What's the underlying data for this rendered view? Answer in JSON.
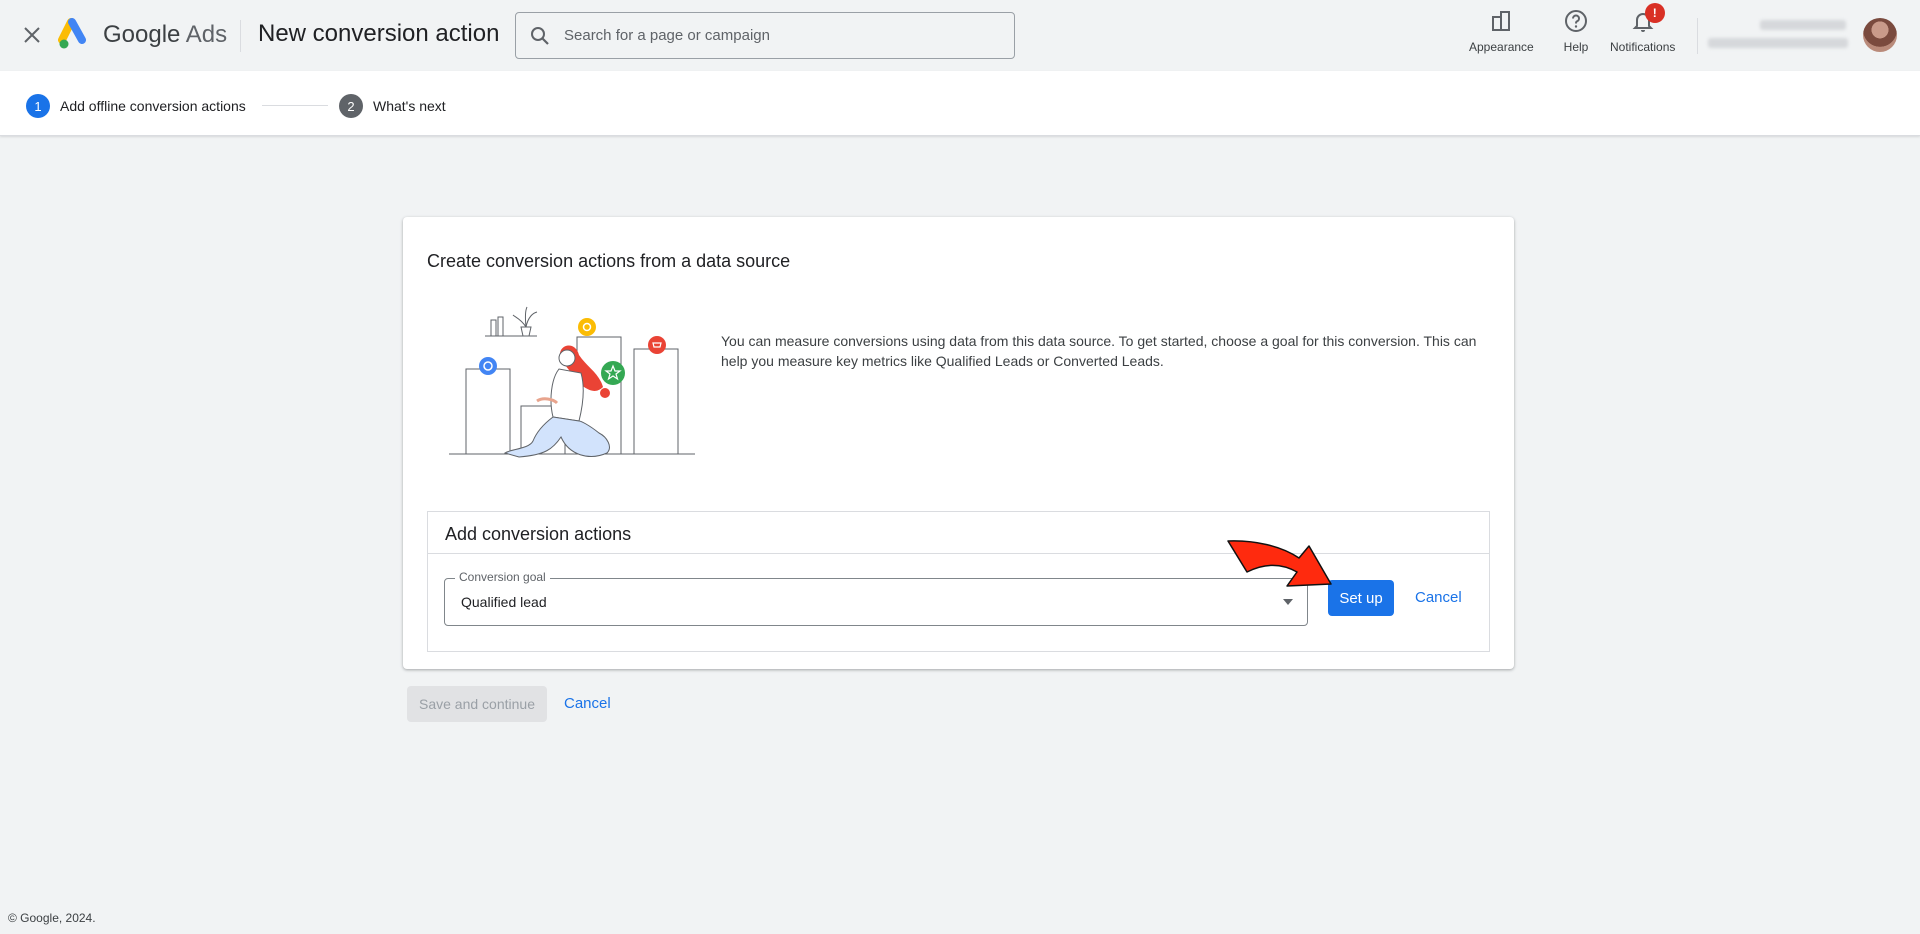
{
  "header": {
    "close_icon": "close-icon",
    "brand_google": "Google",
    "brand_ads": "Ads",
    "page_title": "New conversion action",
    "search_placeholder": "Search for a page or campaign",
    "appearance_label": "Appearance",
    "help_label": "Help",
    "notifications_label": "Notifications",
    "notifications_badge": "!"
  },
  "stepper": {
    "steps": [
      {
        "num": "1",
        "label": "Add offline conversion actions"
      },
      {
        "num": "2",
        "label": "What's next"
      }
    ]
  },
  "card": {
    "title": "Create conversion actions from a data source",
    "description": "You can measure conversions using data from this data source. To get started, choose a goal for this conversion. This can help you measure key metrics like Qualified Leads or Converted Leads.",
    "subpanel": {
      "title": "Add conversion actions",
      "goal_label": "Conversion goal",
      "goal_value": "Qualified lead",
      "setup_label": "Set up",
      "cancel_label": "Cancel"
    }
  },
  "footer": {
    "save_label": "Save and continue",
    "cancel_label": "Cancel",
    "copyright": "© Google, 2024."
  },
  "colors": {
    "accent": "#1a73e8",
    "badge": "#d93025",
    "annotation_arrow": "#ff2a0e"
  }
}
